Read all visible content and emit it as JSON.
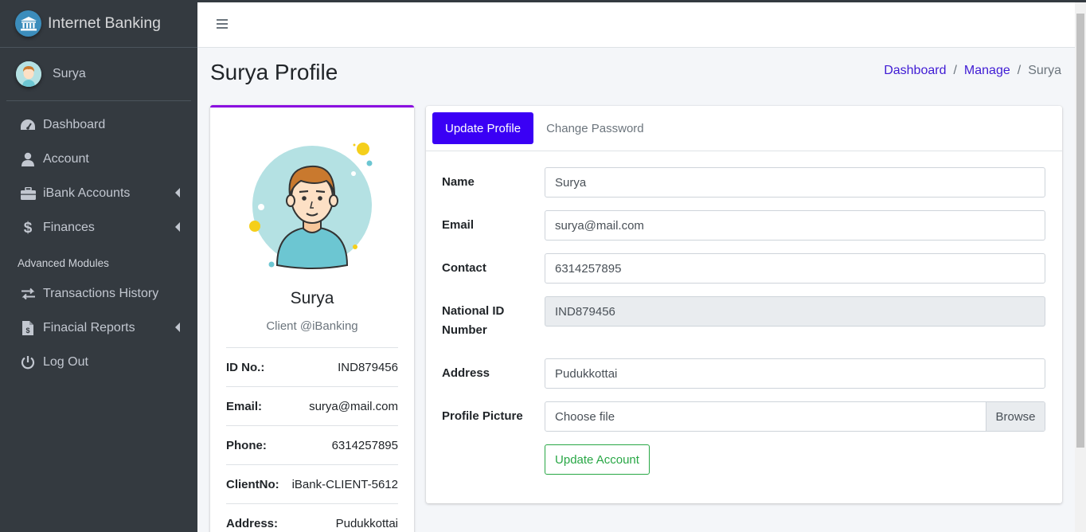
{
  "brand": {
    "name": "Internet Banking"
  },
  "user": {
    "name": "Surya"
  },
  "sidebar": {
    "items": [
      {
        "label": "Dashboard",
        "icon": "tachometer-icon"
      },
      {
        "label": "Account",
        "icon": "user-icon"
      },
      {
        "label": "iBank Accounts",
        "icon": "briefcase-icon",
        "has_submenu": true
      },
      {
        "label": "Finances",
        "icon": "dollar-icon",
        "has_submenu": true
      }
    ],
    "header": "Advanced Modules",
    "advanced_items": [
      {
        "label": "Transactions History",
        "icon": "exchange-icon"
      },
      {
        "label": "Finacial Reports",
        "icon": "file-invoice-dollar-icon",
        "has_submenu": true
      },
      {
        "label": "Log Out",
        "icon": "power-off-icon"
      }
    ]
  },
  "page": {
    "title": "Surya Profile",
    "breadcrumb": {
      "home": "Dashboard",
      "manage": "Manage",
      "current": "Surya",
      "separator": "/"
    }
  },
  "profile": {
    "name": "Surya",
    "subtitle": "Client @iBanking",
    "details": [
      {
        "label": "ID No.:",
        "value": "IND879456"
      },
      {
        "label": "Email:",
        "value": "surya@mail.com"
      },
      {
        "label": "Phone:",
        "value": "6314257895"
      },
      {
        "label": "ClientNo:",
        "value": "iBank-CLIENT-5612"
      },
      {
        "label": "Address:",
        "value": "Pudukkottai"
      }
    ]
  },
  "tabs": {
    "update_profile": "Update Profile",
    "change_password": "Change Password"
  },
  "form": {
    "name": {
      "label": "Name",
      "value": "Surya"
    },
    "email": {
      "label": "Email",
      "value": "surya@mail.com"
    },
    "contact": {
      "label": "Contact",
      "value": "6314257895"
    },
    "national_id": {
      "label_line1": "National ID",
      "label_line2": "Number",
      "value": "IND879456"
    },
    "address": {
      "label": "Address",
      "value": "Pudukkottai"
    },
    "picture": {
      "label": "Profile Picture",
      "placeholder": "Choose file",
      "browse": "Browse"
    },
    "submit": "Update Account"
  },
  "colors": {
    "sidebar_bg": "#343a40",
    "primary": "#3a00f5",
    "link": "#3f1bd4",
    "card_accent": "#8a0be0",
    "success": "#28a745"
  }
}
